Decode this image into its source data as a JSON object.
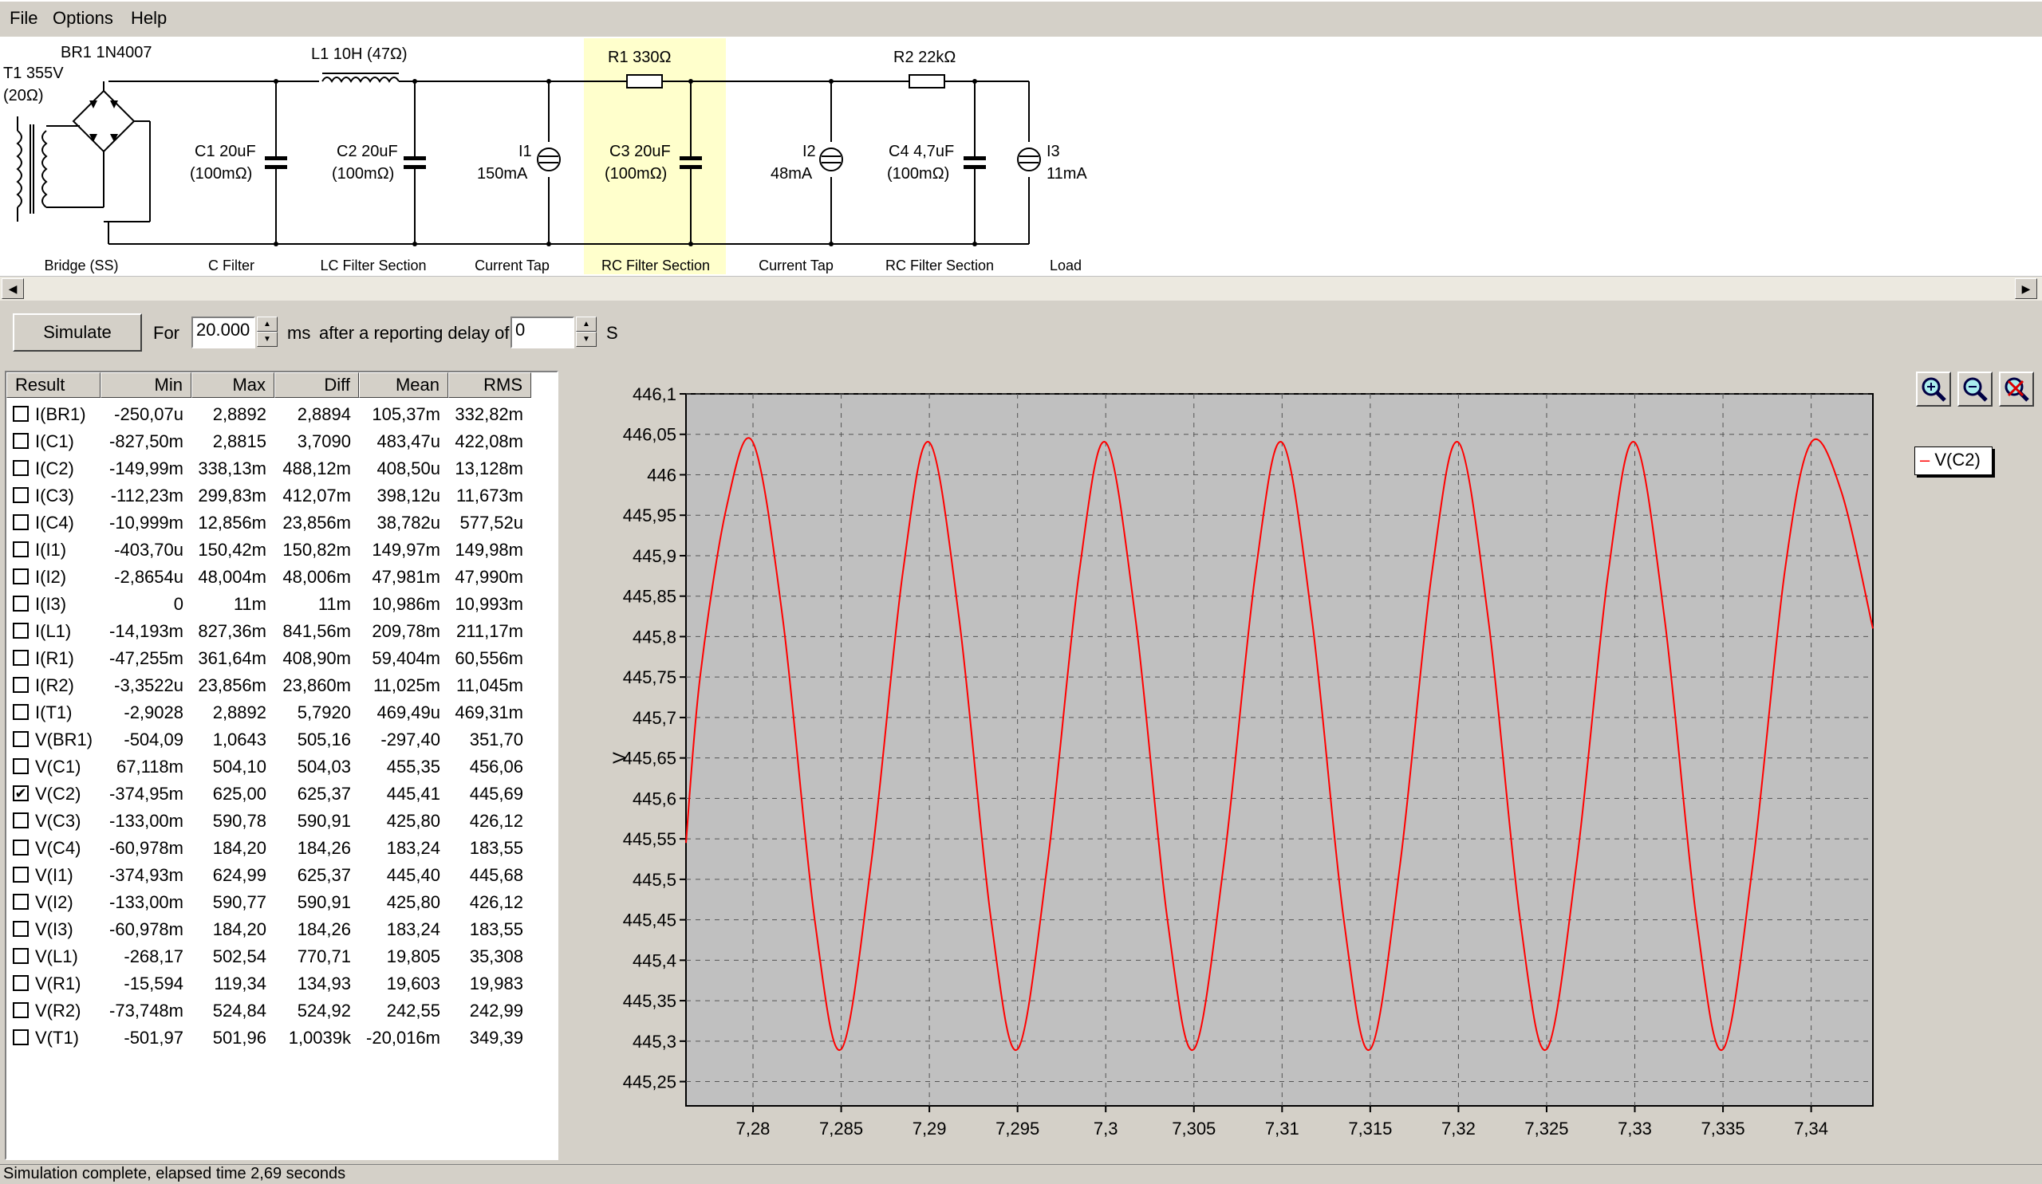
{
  "menu": [
    "File",
    "Options",
    "Help"
  ],
  "schematic": {
    "components": {
      "t1_name": "T1 355V",
      "t1_res": "(20Ω)",
      "br1": "BR1 1N4007",
      "l1": "L1 10H (47Ω)",
      "c1_val": "C1 20uF",
      "c1_esr": "(100mΩ)",
      "c2_val": "C2 20uF",
      "c2_esr": "(100mΩ)",
      "i1_name": "I1",
      "i1_val": "150mA",
      "r1": "R1 330Ω",
      "c3_val": "C3 20uF",
      "c3_esr": "(100mΩ)",
      "i2_name": "I2",
      "i2_val": "48mA",
      "r2": "R2 22kΩ",
      "c4_val": "C4 4,7uF",
      "c4_esr": "(100mΩ)",
      "i3_name": "I3",
      "i3_val": "11mA"
    },
    "sections": [
      "Bridge (SS)",
      "C Filter",
      "LC Filter Section",
      "Current Tap",
      "RC Filter Section",
      "Current Tap",
      "RC Filter Section",
      "Load"
    ]
  },
  "controls": {
    "simulate": "Simulate",
    "for_label": "For",
    "duration": "20.000",
    "ms_label": "ms",
    "delay_label": "after a reporting delay of",
    "delay": "0",
    "s_label": "S"
  },
  "results": {
    "headers": [
      "Result",
      "Min",
      "Max",
      "Diff",
      "Mean",
      "RMS"
    ],
    "rows": [
      {
        "name": "I(BR1)",
        "min": "-250,07u",
        "max": "2,8892",
        "diff": "2,8894",
        "mean": "105,37m",
        "rms": "332,82m",
        "checked": false
      },
      {
        "name": "I(C1)",
        "min": "-827,50m",
        "max": "2,8815",
        "diff": "3,7090",
        "mean": "483,47u",
        "rms": "422,08m",
        "checked": false
      },
      {
        "name": "I(C2)",
        "min": "-149,99m",
        "max": "338,13m",
        "diff": "488,12m",
        "mean": "408,50u",
        "rms": "13,128m",
        "checked": false
      },
      {
        "name": "I(C3)",
        "min": "-112,23m",
        "max": "299,83m",
        "diff": "412,07m",
        "mean": "398,12u",
        "rms": "11,673m",
        "checked": false
      },
      {
        "name": "I(C4)",
        "min": "-10,999m",
        "max": "12,856m",
        "diff": "23,856m",
        "mean": "38,782u",
        "rms": "577,52u",
        "checked": false
      },
      {
        "name": "I(I1)",
        "min": "-403,70u",
        "max": "150,42m",
        "diff": "150,82m",
        "mean": "149,97m",
        "rms": "149,98m",
        "checked": false
      },
      {
        "name": "I(I2)",
        "min": "-2,8654u",
        "max": "48,004m",
        "diff": "48,006m",
        "mean": "47,981m",
        "rms": "47,990m",
        "checked": false
      },
      {
        "name": "I(I3)",
        "min": "0",
        "max": "11m",
        "diff": "11m",
        "mean": "10,986m",
        "rms": "10,993m",
        "checked": false
      },
      {
        "name": "I(L1)",
        "min": "-14,193m",
        "max": "827,36m",
        "diff": "841,56m",
        "mean": "209,78m",
        "rms": "211,17m",
        "checked": false
      },
      {
        "name": "I(R1)",
        "min": "-47,255m",
        "max": "361,64m",
        "diff": "408,90m",
        "mean": "59,404m",
        "rms": "60,556m",
        "checked": false
      },
      {
        "name": "I(R2)",
        "min": "-3,3522u",
        "max": "23,856m",
        "diff": "23,860m",
        "mean": "11,025m",
        "rms": "11,045m",
        "checked": false
      },
      {
        "name": "I(T1)",
        "min": "-2,9028",
        "max": "2,8892",
        "diff": "5,7920",
        "mean": "469,49u",
        "rms": "469,31m",
        "checked": false
      },
      {
        "name": "V(BR1)",
        "min": "-504,09",
        "max": "1,0643",
        "diff": "505,16",
        "mean": "-297,40",
        "rms": "351,70",
        "checked": false
      },
      {
        "name": "V(C1)",
        "min": "67,118m",
        "max": "504,10",
        "diff": "504,03",
        "mean": "455,35",
        "rms": "456,06",
        "checked": false
      },
      {
        "name": "V(C2)",
        "min": "-374,95m",
        "max": "625,00",
        "diff": "625,37",
        "mean": "445,41",
        "rms": "445,69",
        "checked": true
      },
      {
        "name": "V(C3)",
        "min": "-133,00m",
        "max": "590,78",
        "diff": "590,91",
        "mean": "425,80",
        "rms": "426,12",
        "checked": false
      },
      {
        "name": "V(C4)",
        "min": "-60,978m",
        "max": "184,20",
        "diff": "184,26",
        "mean": "183,24",
        "rms": "183,55",
        "checked": false
      },
      {
        "name": "V(I1)",
        "min": "-374,93m",
        "max": "624,99",
        "diff": "625,37",
        "mean": "445,40",
        "rms": "445,68",
        "checked": false
      },
      {
        "name": "V(I2)",
        "min": "-133,00m",
        "max": "590,77",
        "diff": "590,91",
        "mean": "425,80",
        "rms": "426,12",
        "checked": false
      },
      {
        "name": "V(I3)",
        "min": "-60,978m",
        "max": "184,20",
        "diff": "184,26",
        "mean": "183,24",
        "rms": "183,55",
        "checked": false
      },
      {
        "name": "V(L1)",
        "min": "-268,17",
        "max": "502,54",
        "diff": "770,71",
        "mean": "19,805",
        "rms": "35,308",
        "checked": false
      },
      {
        "name": "V(R1)",
        "min": "-15,594",
        "max": "119,34",
        "diff": "134,93",
        "mean": "19,603",
        "rms": "19,983",
        "checked": false
      },
      {
        "name": "V(R2)",
        "min": "-73,748m",
        "max": "524,84",
        "diff": "524,92",
        "mean": "242,55",
        "rms": "242,99",
        "checked": false
      },
      {
        "name": "V(T1)",
        "min": "-501,97",
        "max": "501,96",
        "diff": "1,0039k",
        "mean": "-20,016m",
        "rms": "349,39",
        "checked": false
      }
    ]
  },
  "zoom_icons": [
    "zoom-in-icon",
    "zoom-out-icon",
    "zoom-reset-icon"
  ],
  "chart_data": {
    "type": "line",
    "ylabel": "V",
    "xlim": [
      7.2762,
      7.3435
    ],
    "ylim": [
      445.22,
      446.1
    ],
    "xticks": [
      7.28,
      7.285,
      7.29,
      7.295,
      7.3,
      7.305,
      7.31,
      7.315,
      7.32,
      7.325,
      7.33,
      7.335,
      7.34
    ],
    "xtick_labels": [
      "7,28",
      "7,285",
      "7,29",
      "7,295",
      "7,3",
      "7,305",
      "7,31",
      "7,315",
      "7,32",
      "7,325",
      "7,33",
      "7,335",
      "7,34"
    ],
    "yticks": [
      446.1,
      446.05,
      446,
      445.95,
      445.9,
      445.85,
      445.8,
      445.75,
      445.7,
      445.65,
      445.6,
      445.55,
      445.5,
      445.45,
      445.4,
      445.35,
      445.3,
      445.25
    ],
    "ytick_labels": [
      "446,1",
      "446,05",
      "446",
      "445,95",
      "445,9",
      "445,85",
      "445,8",
      "445,75",
      "445,7",
      "445,65",
      "445,6",
      "445,55",
      "445,5",
      "445,45",
      "445,4",
      "445,35",
      "445,3",
      "445,25"
    ],
    "grid": true,
    "legend": "top-right",
    "series": [
      {
        "name": "V(C2)",
        "color": "#ff0000",
        "x": [
          7.2762,
          7.277,
          7.2785,
          7.28,
          7.2817,
          7.2835,
          7.285,
          7.2867,
          7.2885,
          7.29,
          7.2917,
          7.2935,
          7.295,
          7.2967,
          7.2985,
          7.3,
          7.3017,
          7.3035,
          7.305,
          7.3067,
          7.3085,
          7.31,
          7.3117,
          7.3135,
          7.315,
          7.3167,
          7.3185,
          7.32,
          7.3217,
          7.3235,
          7.325,
          7.3267,
          7.3285,
          7.33,
          7.3317,
          7.3335,
          7.335,
          7.3367,
          7.3385,
          7.34,
          7.3417,
          7.3435
        ],
        "y": [
          445.545,
          445.75,
          445.96,
          446.04,
          445.82,
          445.45,
          445.29,
          445.52,
          445.88,
          446.04,
          445.82,
          445.45,
          445.29,
          445.52,
          445.88,
          446.04,
          445.82,
          445.45,
          445.29,
          445.52,
          445.88,
          446.04,
          445.82,
          445.45,
          445.29,
          445.52,
          445.88,
          446.04,
          445.82,
          445.45,
          445.29,
          445.52,
          445.88,
          446.04,
          445.82,
          445.45,
          445.29,
          445.52,
          445.88,
          446.04,
          445.98,
          445.81
        ]
      }
    ]
  },
  "status": "Simulation complete, elapsed time 2,69 seconds"
}
